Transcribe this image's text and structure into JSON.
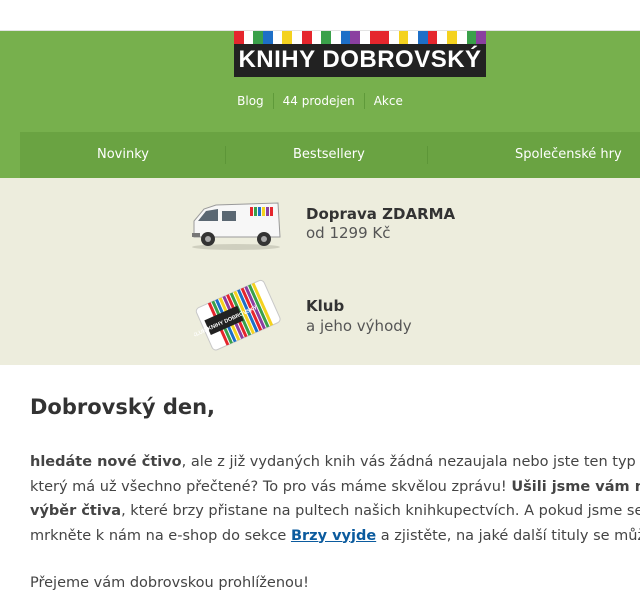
{
  "brand": {
    "logo_text": "KNIHY DOBROVSKÝ",
    "stripe_colors": [
      "#e5262d",
      "#ffffff",
      "#3aa04a",
      "#1d6fc7",
      "#ffffff",
      "#f4d21f",
      "#ffffff",
      "#e5262d",
      "#ffffff",
      "#3aa04a",
      "#ffffff",
      "#1d6fc7",
      "#8a3fa0",
      "#ffffff",
      "#e5262d",
      "#e5262d",
      "#ffffff",
      "#f4d21f",
      "#ffffff",
      "#1d6fc7",
      "#e5262d",
      "#ffffff",
      "#f4d21f",
      "#ffffff",
      "#3aa04a",
      "#8a3fa0"
    ]
  },
  "toplinks": [
    "Blog",
    "44 prodejen",
    "Akce"
  ],
  "nav": [
    "Novinky",
    "Bestsellery",
    "Společenské hry"
  ],
  "benefits": {
    "shipping_title": "Doprava ZDARMA",
    "shipping_sub": "od 1299 Kč",
    "club_title": "Klub",
    "club_sub": "a jeho výhody",
    "card_text": "KLUB KNIHY DOBROVSKÝ"
  },
  "content": {
    "greeting": "Dobrovský den,",
    "p1_b1": "hledáte nové čtivo",
    "p1_t1": ", ale z již vydaných knih vás žádná nezaujala nebo jste ten typ knihomola,",
    "p1_t2": "který má už všechno přečtené? To pro vás máme skvělou zprávu! ",
    "p1_b2": "Ušili jsme vám na míru",
    "p1_b3": "výběr čtiva",
    "p1_t3": ", které brzy přistane na pultech našich knihkupectvích. A pokud jsme se netrefili,",
    "p1_t4": "mrkněte k nám na e-shop do sekce ",
    "p1_link": "Brzy vyjde",
    "p1_t5": " a zjistěte, na jaké další tituly se můžete těšit.",
    "closing": "Přejeme vám dobrovskou prohlíženou!"
  }
}
